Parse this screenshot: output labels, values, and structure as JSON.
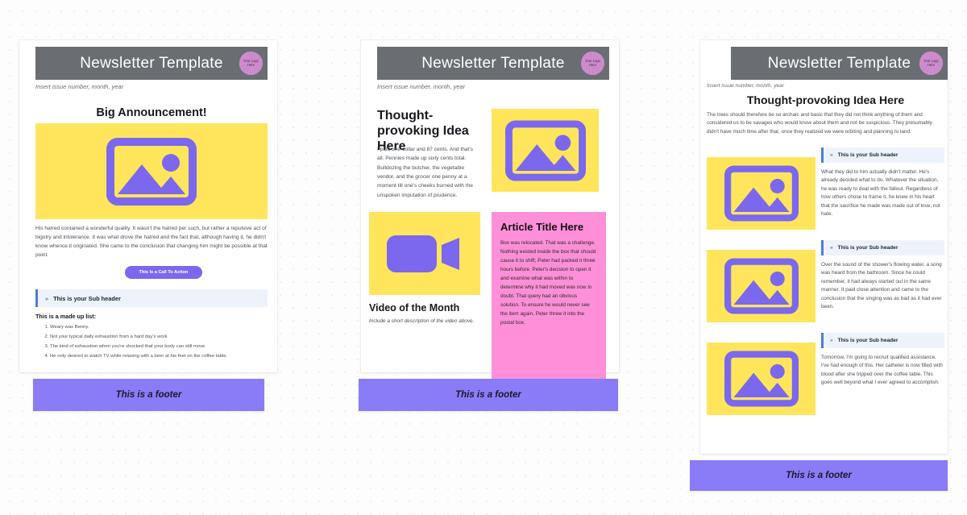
{
  "background": {
    "color": "#fdfdfd",
    "dot_color": "#ececec"
  },
  "colors": {
    "header_bar": "#6a6e73",
    "logo_blob": "#cf8fcf",
    "accent_purple": "#7b68ee",
    "footer_purple": "#8a7bf7",
    "placeholder_yellow": "#ffe55c",
    "placeholder_icon": "#7b68ee",
    "pink_box": "#ff8fd8",
    "subheader_bg": "#eef3fb",
    "subheader_rule": "#4a7fd4"
  },
  "common": {
    "brand_title": "Newsletter Template",
    "logo_text": "Your Logo Here",
    "issue_line": "Insert issue number, month, year",
    "footer_text": "This is a footer",
    "subheader_text": "This is your Sub header",
    "subheader_glyph": "»"
  },
  "column1": {
    "section_title": "Big Announcement!",
    "body": "His hatred contained a wonderful quality. It wasn't the hatred per such, but rather a repulsive act of bigotry and intolerance. It was what drove the hatred and the fact that, although having it, he didn't know whence it originated. She came to the conclusion that changing him might be possible at that point.",
    "cta_label": "This Is a Call To Action",
    "list_title": "This is a made up list:",
    "list_items": [
      "Weary was Benny.",
      "Not your typical daily exhaustion from a hard day's work",
      "The kind of exhaustion when you're shocked that your body can still move",
      "He only desired to watch TV while relaxing with a beer at his feet on the coffee table."
    ]
  },
  "column2": {
    "section_title": "Thought-provoking Idea Here",
    "body": "I paid one dollar and 87 cents. And that's all. Pennies made up sixty cents total. Bulldozing the butcher, the vegetable vendor, and the grocer one penny at a moment till one's cheeks burned with the unspoken imputation of prudence.",
    "video_title": "Video of the Month",
    "video_desc": "Include a short description of the video above.",
    "article_title": "Article Title Here",
    "article_body": "Box was relocated. That was a challenge. Nothing existed inside the box that should cause it to shift; Peter had packed it three hours before. Peter's decision to open it and examine what was within to determine why it had moved was now in doubt. That query had an obvious solution. To ensure he would never see the item again, Peter threw it into the postal box."
  },
  "column3": {
    "section_title": "Thought-provoking Idea Here",
    "intro": "The trees should therefore be so archaic and basic that they did not think anything of them and considered us to be savages who would know about them and not be suspicious. They presumably didn't have much time after that, once they realized we were orbiting and planning to land.",
    "blocks": [
      {
        "subheader": "This is your Sub header",
        "text": "What they did to him actually didn't matter. He's already decided what to do. Whatever the situation, he was ready to deal with the fallout. Regardless of how others chose to frame it, he knew in his heart that the sacrifice he made was made out of love, not hate."
      },
      {
        "subheader": "This is your Sub header",
        "text": "Over the sound of the shower's flowing water, a song was heard from the bathroom. Since he could remember, it had always started out in the same manner. It paid close attention and came to the conclusion that the singing was as bad as it had ever been."
      },
      {
        "subheader": "This is your Sub header",
        "text": "Tomorrow, I'm going to recruit qualified assistance. I've had enough of this. Her catheter is now filled with blood after she tripped over the coffee table. This goes well beyond what I ever agreed to accomplish."
      }
    ]
  }
}
